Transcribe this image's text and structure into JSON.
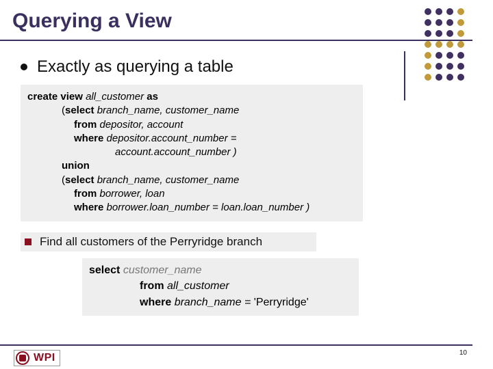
{
  "title": "Querying a View",
  "bullet1": "Exactly as querying a table",
  "code1": {
    "l1a": "create view ",
    "l1b": "all_customer ",
    "l1c": "as",
    "l2a": "(",
    "l2b": "select ",
    "l2c": "branch_name, customer_name",
    "l3a": "from ",
    "l3b": "depositor, account",
    "l4a": "where ",
    "l4b": "depositor.account_number =",
    "l5": "account.account_number )",
    "l6": "union",
    "l7a": "(",
    "l7b": "select ",
    "l7c": "branch_name, customer_name",
    "l8a": "from ",
    "l8b": "borrower, loan",
    "l9a": "where ",
    "l9b": "borrower.loan_number = loan.loan_number )"
  },
  "bullet2": "Find all customers of the Perryridge branch",
  "code2": {
    "l1a": "select ",
    "l1b": "customer_name",
    "l2a": "from ",
    "l2b": "all_customer",
    "l3a": "where ",
    "l3b": "branch_name = ",
    "l3c": "'Perryridge'"
  },
  "logo_text": "WPI",
  "page_number": "10"
}
